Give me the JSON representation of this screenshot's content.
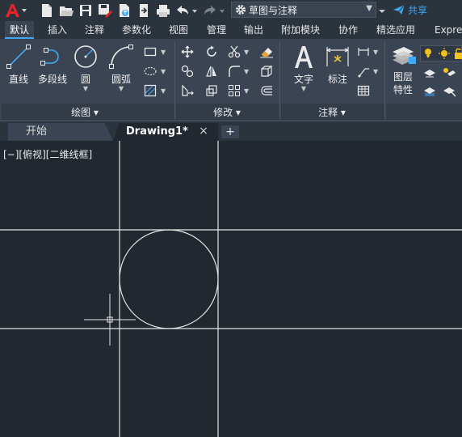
{
  "quick_access": {
    "workspace_label": "草图与注释",
    "share_label": "共享"
  },
  "ribbon_tabs": [
    {
      "label": "默认",
      "active": true
    },
    {
      "label": "插入"
    },
    {
      "label": "注释"
    },
    {
      "label": "参数化"
    },
    {
      "label": "视图"
    },
    {
      "label": "管理"
    },
    {
      "label": "输出"
    },
    {
      "label": "附加模块"
    },
    {
      "label": "协作"
    },
    {
      "label": "精选应用"
    },
    {
      "label": "Expre"
    }
  ],
  "panels": {
    "draw": {
      "title": "绘图",
      "tools": {
        "line": "直线",
        "polyline": "多段线",
        "circle": "圆",
        "arc": "圆弧"
      }
    },
    "modify": {
      "title": "修改"
    },
    "annotation": {
      "title": "注释",
      "tools": {
        "text": "文字",
        "dimension": "标注"
      }
    },
    "layers": {
      "tools": {
        "layer_properties_line1": "图层",
        "layer_properties_line2": "特性"
      }
    }
  },
  "file_tabs": {
    "start_label": "开始",
    "drawing_label": "Drawing1*",
    "close_glyph": "×",
    "new_glyph": "+"
  },
  "canvas": {
    "viewport_label": "[−][俯视][二维线框]",
    "line_color": "#e6e6e6"
  }
}
